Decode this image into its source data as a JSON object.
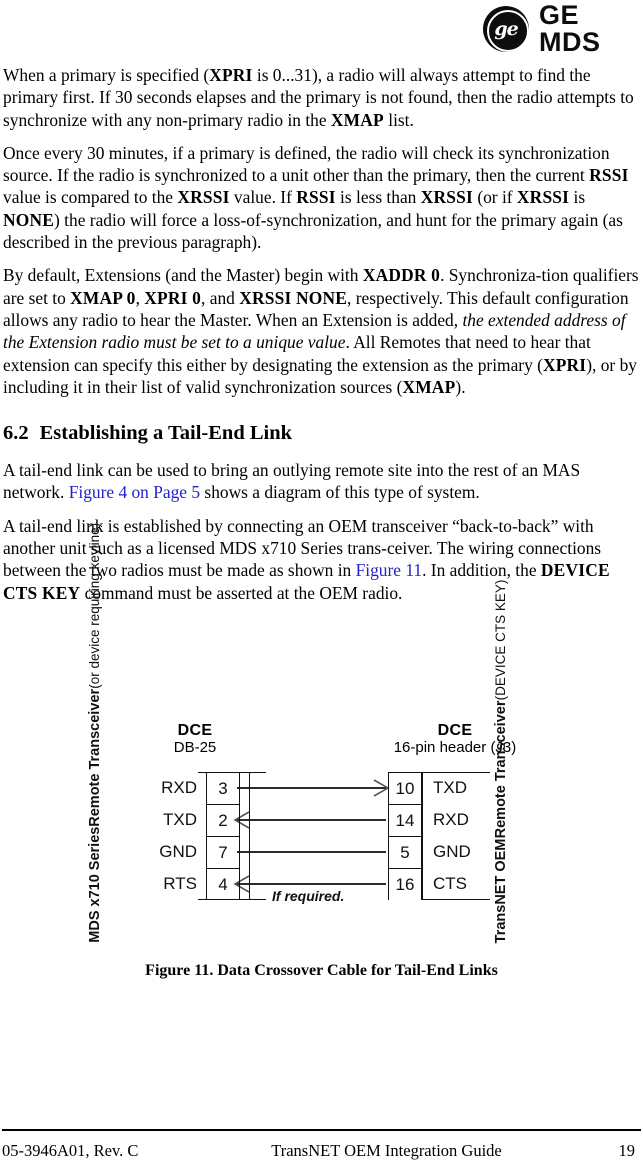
{
  "logo": {
    "monogram_text": "ge",
    "wordmark": "GE MDS",
    "name": "ge-mds-logo"
  },
  "paragraphs": [
    {
      "id": "p1",
      "runs": [
        {
          "text": "When a primary is specified (",
          "style": "normal"
        },
        {
          "text": "XPRI",
          "style": "smallcaps"
        },
        {
          "text": " is 0...31), a radio will always attempt to find the primary first. If 30 seconds elapses and the primary is not found, then the radio attempts to synchronize with any non-primary radio in the ",
          "style": "normal"
        },
        {
          "text": "XMAP",
          "style": "smallcaps"
        },
        {
          "text": " list.",
          "style": "normal"
        }
      ]
    },
    {
      "id": "p2",
      "runs": [
        {
          "text": "Once every 30 minutes, if a primary is defined, the radio will check its synchronization source. If the radio is synchronized to a unit other than the primary, then the current ",
          "style": "normal"
        },
        {
          "text": "RSSI",
          "style": "smallcaps"
        },
        {
          "text": " value is compared to the ",
          "style": "normal"
        },
        {
          "text": "XRSSI",
          "style": "smallcaps"
        },
        {
          "text": " value. If ",
          "style": "normal"
        },
        {
          "text": "RSSI",
          "style": "smallcaps"
        },
        {
          "text": " is less than ",
          "style": "normal"
        },
        {
          "text": "XRSSI",
          "style": "smallcaps"
        },
        {
          "text": " (or if ",
          "style": "normal"
        },
        {
          "text": "XRSSI",
          "style": "smallcaps"
        },
        {
          "text": " is ",
          "style": "normal"
        },
        {
          "text": "NONE",
          "style": "smallcaps"
        },
        {
          "text": ") the radio will force a loss-of-synchronization, and hunt for the primary again (as described in the previous paragraph).",
          "style": "normal"
        }
      ]
    },
    {
      "id": "p3",
      "runs": [
        {
          "text": "By default, Extensions (and the Master) begin with ",
          "style": "normal"
        },
        {
          "text": "XADDR 0",
          "style": "smallcaps"
        },
        {
          "text": ". Synchroniza-tion qualifiers are set to ",
          "style": "normal"
        },
        {
          "text": "XMAP 0",
          "style": "smallcaps"
        },
        {
          "text": ", ",
          "style": "normal"
        },
        {
          "text": "XPRI 0",
          "style": "smallcaps"
        },
        {
          "text": ", and ",
          "style": "normal"
        },
        {
          "text": "XRSSI NONE",
          "style": "smallcaps"
        },
        {
          "text": ", respectively. This default configuration allows any radio to hear the Master. When an Extension is added, ",
          "style": "normal"
        },
        {
          "text": "the extended address of the Extension radio must be set to a unique value",
          "style": "italic"
        },
        {
          "text": ". All Remotes that need to hear that extension can specify this either by designating the extension as the primary (",
          "style": "normal"
        },
        {
          "text": "XPRI",
          "style": "smallcaps"
        },
        {
          "text": "), or by including it in their list of valid synchronization sources (",
          "style": "normal"
        },
        {
          "text": "XMAP",
          "style": "smallcaps"
        },
        {
          "text": ").",
          "style": "normal"
        }
      ]
    }
  ],
  "section": {
    "number": "6.2",
    "title": "Establishing a Tail-End Link"
  },
  "paragraphs_after_section": [
    {
      "id": "p4",
      "runs": [
        {
          "text": "A tail-end link can be used to bring an outlying remote site into the rest of an MAS network. ",
          "style": "normal"
        },
        {
          "text": "Figure 4 on Page 5",
          "style": "link"
        },
        {
          "text": " shows a diagram of this type of system.",
          "style": "normal"
        }
      ]
    },
    {
      "id": "p5",
      "runs": [
        {
          "text": "A tail-end link is established by connecting an OEM transceiver “back-to-back” with another unit such as a licensed MDS x710 Series trans-ceiver. The wiring connections between the two radios must be made as shown in ",
          "style": "normal"
        },
        {
          "text": "Figure 11",
          "style": "link"
        },
        {
          "text": ". In addition, the ",
          "style": "normal"
        },
        {
          "text": "DEVICE CTS KEY",
          "style": "smallcaps"
        },
        {
          "text": " command must be asserted at the OEM radio.",
          "style": "normal"
        }
      ]
    }
  ],
  "figure": {
    "caption": "Figure 11. Data Crossover Cable for Tail-End Links",
    "left_device": {
      "line1": "MDS x710 Series",
      "line2": "Remote Transceiver",
      "line3": "(or device requiring keyline)"
    },
    "right_device": {
      "line1": "TransNET OEM",
      "line2": "Remote Transceiver",
      "line3": "(DEVICE CTS KEY)"
    },
    "left_connector": {
      "type": "DCE",
      "subtitle": "DB-25",
      "rows": [
        {
          "signal": "RXD",
          "pin": "3"
        },
        {
          "signal": "TXD",
          "pin": "2"
        },
        {
          "signal": "GND",
          "pin": "7"
        },
        {
          "signal": "RTS",
          "pin": "4"
        }
      ]
    },
    "right_connector": {
      "type": "DCE",
      "subtitle": "16-pin header (J3)",
      "rows": [
        {
          "pin": "10",
          "signal": "TXD"
        },
        {
          "pin": "14",
          "signal": "RXD"
        },
        {
          "pin": "5",
          "signal": "GND"
        },
        {
          "pin": "16",
          "signal": "CTS"
        }
      ]
    },
    "connections": [
      {
        "from": "3",
        "to": "10",
        "direction": "right",
        "note": ""
      },
      {
        "from": "14",
        "to": "2",
        "direction": "left",
        "note": ""
      },
      {
        "from": "7",
        "to": "5",
        "direction": "none",
        "note": ""
      },
      {
        "from": "16",
        "to": "4",
        "direction": "left",
        "note": "If required."
      }
    ],
    "annotation": "If required."
  },
  "footer": {
    "left": "05-3946A01, Rev. C",
    "center": "TransNET OEM Integration Guide",
    "right": "19"
  },
  "colors": {
    "link": "#2222cc",
    "text": "#000000",
    "rule": "#000000"
  }
}
